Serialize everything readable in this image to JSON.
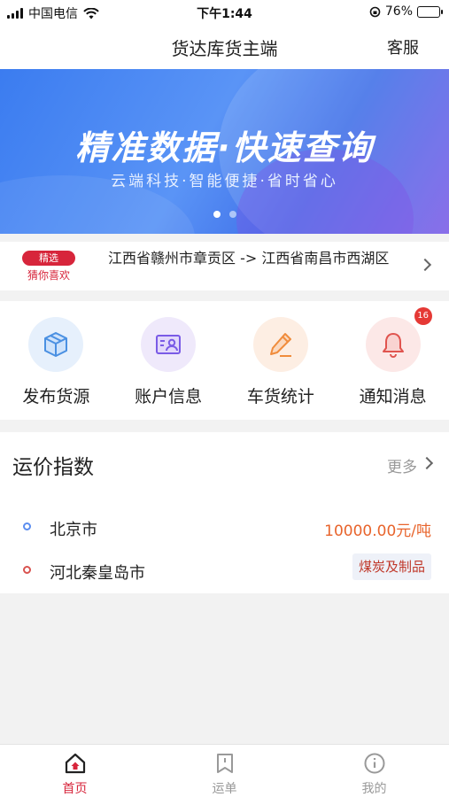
{
  "status_bar": {
    "carrier": "中国电信",
    "time": "下午1:44",
    "battery": "76%",
    "battery_level": 0.76
  },
  "nav": {
    "title": "货达库货主端",
    "service": "客服"
  },
  "banner": {
    "title": "精准数据·快速查询",
    "subtitle": "云端科技·智能便捷·省时省心",
    "page_count": 2,
    "active_index": 0
  },
  "recommend": {
    "badge": "精选",
    "sub": "猜你喜欢",
    "route": "江西省赣州市章贡区 -> 江西省南昌市西湖区"
  },
  "quick_actions": [
    {
      "label": "发布货源",
      "icon": "package-icon",
      "color": "#4a90e2"
    },
    {
      "label": "账户信息",
      "icon": "id-card-icon",
      "color": "#7a5be6"
    },
    {
      "label": "车货统计",
      "icon": "pencil-icon",
      "color": "#f08c3c"
    },
    {
      "label": "通知消息",
      "icon": "bell-icon",
      "color": "#e0544f",
      "badge": "16"
    }
  ],
  "freight_index": {
    "title": "运价指数",
    "more": "更多",
    "from_city": "北京市",
    "to_city": "河北秦皇岛市",
    "price": "10000.00元/吨",
    "category": "煤炭及制品"
  },
  "tabs": [
    {
      "label": "首页",
      "icon": "home-icon",
      "active": true
    },
    {
      "label": "运单",
      "icon": "bookmark-icon",
      "active": false
    },
    {
      "label": "我的",
      "icon": "profile-icon",
      "active": false
    }
  ],
  "colors": {
    "accent": "#d7253b",
    "price": "#e8642c",
    "banner_blue": "#3b7cf0"
  }
}
